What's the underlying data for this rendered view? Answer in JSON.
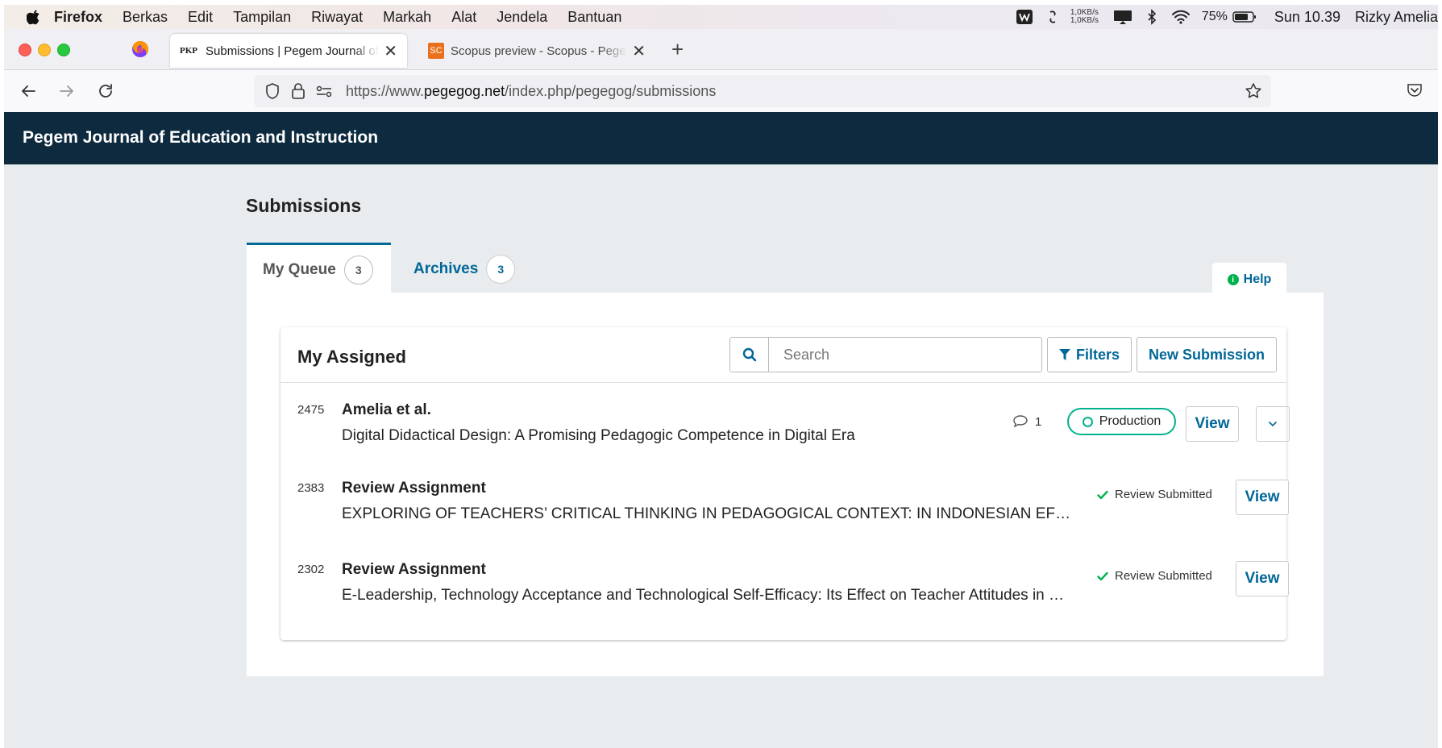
{
  "menubar": {
    "items": [
      "Firefox",
      "Berkas",
      "Edit",
      "Tampilan",
      "Riwayat",
      "Markah",
      "Alat",
      "Jendela",
      "Bantuan"
    ],
    "net_up": "1,0KB/s",
    "net_down": "1,0KB/s",
    "battery": "75%",
    "clock": "Sun 10.39",
    "user": "Rizky Amelia"
  },
  "browser": {
    "tabs": [
      {
        "favicon": "PKP",
        "title": "Submissions | Pegem Journal of Education and Instruction"
      },
      {
        "favicon": "SC",
        "title": "Scopus preview - Scopus - Pegem Journal"
      }
    ],
    "url_prefix": "https://www.",
    "url_domain": "pegegog.net",
    "url_path": "/index.php/pegegog/submissions"
  },
  "site": {
    "title": "Pegem Journal of Education and Instruction"
  },
  "page": {
    "title": "Submissions",
    "tabs": [
      {
        "label": "My Queue",
        "count": "3"
      },
      {
        "label": "Archives",
        "count": "3"
      }
    ],
    "help": "Help"
  },
  "list": {
    "title": "My Assigned",
    "search_placeholder": "Search",
    "filters_label": "Filters",
    "new_submission_label": "New Submission",
    "view_label": "View",
    "rows": [
      {
        "id": "2475",
        "author": "Amelia et al.",
        "title": "Digital Didactical Design: A Promising Pedagogic Competence in Digital Era",
        "comments": "1",
        "stage": "Production"
      },
      {
        "id": "2383",
        "author": "Review Assignment",
        "title": "EXPLORING OF TEACHERS’ CRITICAL THINKING IN PEDAGOGICAL CONTEXT: IN INDONESIAN EFL TEACHERS’ PERSPECTIVES",
        "status": "Review Submitted"
      },
      {
        "id": "2302",
        "author": "Review Assignment",
        "title": "E-Leadership, Technology Acceptance and Technological Self-Efficacy: Its Effect on Teacher Attitudes in Online Teaching",
        "status": "Review Submitted"
      }
    ]
  },
  "colors": {
    "header": "#0d2a3f",
    "link": "#006798",
    "production": "#00b28e",
    "check": "#00b24e"
  }
}
